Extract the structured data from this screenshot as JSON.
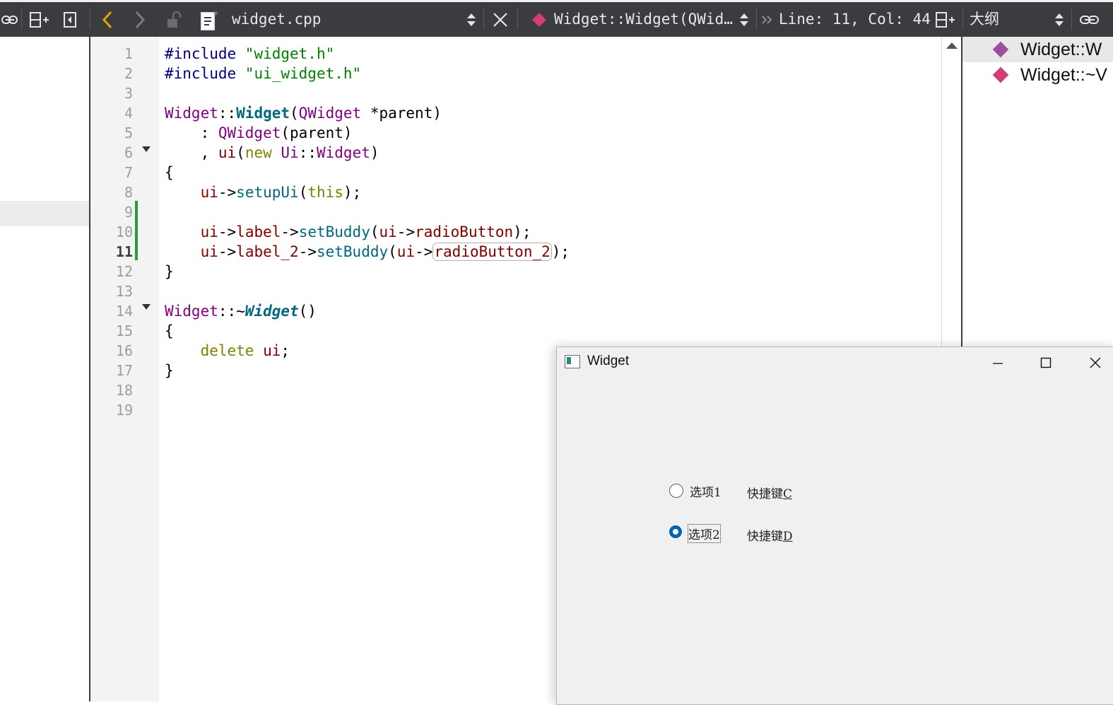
{
  "toolbar": {
    "file_name": "widget.cpp",
    "symbol": "Widget::Widget(QWid…",
    "position": "Line: 11, Col: 44",
    "outline_title": "大纲"
  },
  "editor": {
    "line_numbers": [
      "1",
      "2",
      "3",
      "4",
      "5",
      "6",
      "7",
      "8",
      "9",
      "10",
      "11",
      "12",
      "13",
      "14",
      "15",
      "16",
      "17",
      "18",
      "19"
    ],
    "current_line": "11",
    "lines": {
      "l1": {
        "a": "#include ",
        "b": "\"widget.h\""
      },
      "l2": {
        "a": "#include ",
        "b": "\"ui_widget.h\""
      },
      "l4": {
        "a": "Widget",
        "b": "::",
        "c": "Widget",
        "d": "(",
        "e": "QWidget",
        "f": " *parent)"
      },
      "l5": {
        "a": "    : ",
        "b": "QWidget",
        "c": "(parent)"
      },
      "l6": {
        "a": "    , ",
        "b": "ui",
        "c": "(",
        "d": "new",
        "e": " ",
        "f": "Ui",
        "g": "::",
        "h": "Widget",
        "i": ")"
      },
      "l7": {
        "a": "{"
      },
      "l8": {
        "a": "    ",
        "b": "ui",
        "c": "->",
        "d": "setupUi",
        "e": "(",
        "f": "this",
        "g": ");"
      },
      "l10": {
        "a": "    ",
        "b": "ui",
        "c": "->",
        "d": "label",
        "e": "->",
        "f": "setBuddy",
        "g": "(",
        "h": "ui",
        "i": "->",
        "j": "radioButton",
        "k": ");"
      },
      "l11": {
        "a": "    ",
        "b": "ui",
        "c": "->",
        "d": "label_2",
        "e": "->",
        "f": "setBuddy",
        "g": "(",
        "h": "ui",
        "i": "->",
        "j": "radioButton_2",
        "k": ");"
      },
      "l12": {
        "a": "}"
      },
      "l14": {
        "a": "Widget",
        "b": "::~",
        "c": "Widget",
        "d": "()"
      },
      "l15": {
        "a": "{"
      },
      "l16": {
        "a": "    ",
        "b": "delete",
        "c": " ",
        "d": "ui",
        "e": ";"
      },
      "l17": {
        "a": "}"
      }
    }
  },
  "outline": {
    "items": [
      {
        "label": "Widget::W",
        "color": "#9b4f9e"
      },
      {
        "label": "Widget::~V",
        "color": "#d63d75"
      }
    ]
  },
  "app_window": {
    "title": "Widget",
    "radio1_label": "选项1",
    "radio2_label": "选项2",
    "label1_text": "快捷键",
    "label1_key": "C",
    "label2_text": "快捷键",
    "label2_key": "D",
    "radio1_checked": false,
    "radio2_checked": true
  },
  "colors": {
    "toolbar_bg": "#3a3c3f",
    "accent_yellow": "#e0a400",
    "radio_checked": "#0063b1",
    "change_bar": "#2a9a3a"
  }
}
